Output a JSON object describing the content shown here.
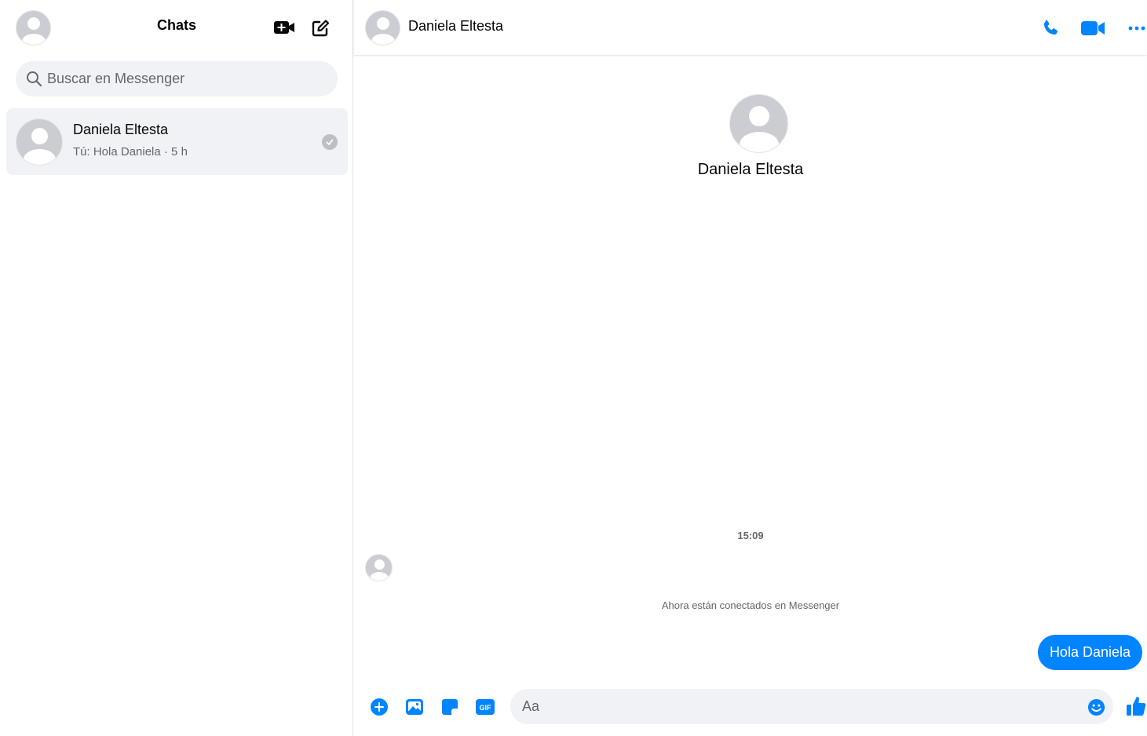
{
  "sidebar": {
    "title": "Chats",
    "search_placeholder": "Buscar en Messenger",
    "chats": [
      {
        "name": "Daniela Eltesta",
        "preview": "Tú: Hola Daniela · 5 h"
      }
    ]
  },
  "conversation": {
    "contact_name": "Daniela Eltesta",
    "profile_name": "Daniela Eltesta",
    "timestamp": "15:09",
    "system_message": "Ahora están conectados en Messenger",
    "messages": [
      {
        "from": "me",
        "text": "Hola Daniela"
      }
    ],
    "composer_placeholder": "Aa"
  },
  "icons": {
    "new_room": "video-plus-icon",
    "new_message": "compose-icon",
    "call": "phone-icon",
    "video": "video-icon",
    "more": "more-dots-icon",
    "plus": "plus-circle-icon",
    "image": "image-icon",
    "sticker": "sticker-icon",
    "gif": "gif-icon",
    "emoji": "emoji-icon",
    "like": "thumbs-up-icon"
  },
  "colors": {
    "accent": "#0084ff",
    "surface": "#f0f2f5",
    "muted_text": "#65676b"
  }
}
